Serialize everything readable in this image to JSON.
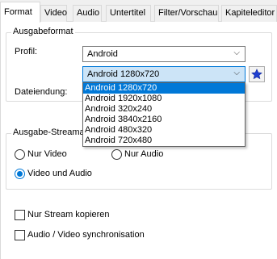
{
  "tabs": [
    {
      "label": "Format",
      "active": true
    },
    {
      "label": "Video"
    },
    {
      "label": "Audio"
    },
    {
      "label": "Untertitel"
    },
    {
      "label": "Filter/Vorschau"
    },
    {
      "label": "Kapiteleditor"
    }
  ],
  "output_format": {
    "legend": "Ausgabeformat",
    "profile_label": "Profil:",
    "profile_value": "Android",
    "preset_value": "Android 1280x720",
    "extension_label": "Dateiendung:",
    "preset_options": [
      "Android 1280x720",
      "Android 1920x1080",
      "Android 320x240",
      "Android 3840x2160",
      "Android 480x320",
      "Android 720x480"
    ],
    "selected_option_index": 0
  },
  "stream": {
    "legend": "Ausgabe-Streama",
    "options": [
      "Nur Video",
      "Nur Audio",
      "Video und Audio"
    ],
    "selected": "Video und Audio"
  },
  "checkboxes": {
    "copy_stream": {
      "label": "Nur Stream kopieren",
      "checked": false
    },
    "av_sync": {
      "label": "Audio / Video synchronisation",
      "checked": false
    }
  },
  "colors": {
    "accent": "#0078d7",
    "star": "#1f3fd1"
  }
}
